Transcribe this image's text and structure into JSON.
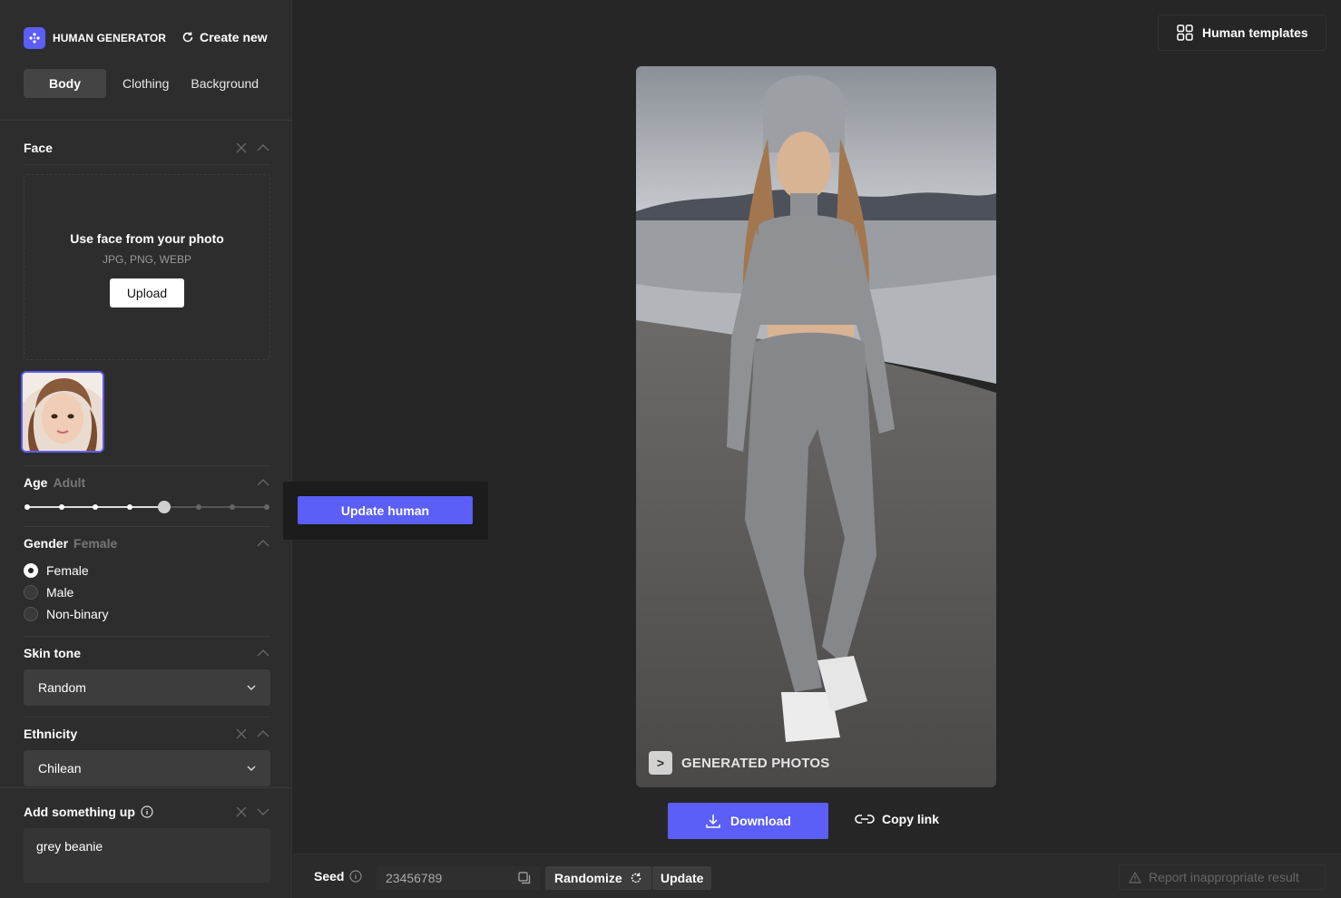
{
  "brand": {
    "name": "HUMAN GENERATOR",
    "accent": "#5b5ef7"
  },
  "header": {
    "create_new": "Create new",
    "templates": "Human templates"
  },
  "tabs": [
    {
      "label": "Body",
      "active": true
    },
    {
      "label": "Clothing",
      "active": false
    },
    {
      "label": "Background",
      "active": false
    }
  ],
  "face": {
    "title": "Face",
    "upload_title": "Use face from your photo",
    "upload_formats": "JPG, PNG, WEBP",
    "upload_button": "Upload"
  },
  "age": {
    "title": "Age",
    "value": "Adult",
    "steps": 8,
    "selected_index": 4
  },
  "gender": {
    "title": "Gender",
    "value": "Female",
    "options": [
      {
        "label": "Female",
        "checked": true
      },
      {
        "label": "Male",
        "checked": false
      },
      {
        "label": "Non-binary",
        "checked": false
      }
    ]
  },
  "skin_tone": {
    "title": "Skin tone",
    "selected": "Random"
  },
  "ethnicity": {
    "title": "Ethnicity",
    "selected": "Chilean"
  },
  "add_something": {
    "title": "Add something up",
    "value": "grey beanie"
  },
  "update_human": "Update human",
  "photo": {
    "watermark": "GENERATED PHOTOS",
    "watermark_mark": ">"
  },
  "actions": {
    "download": "Download",
    "copy_link": "Copy link"
  },
  "bottom": {
    "seed_label": "Seed",
    "seed_value": "23456789",
    "randomize": "Randomize",
    "update": "Update",
    "report": "Report inappropriate result"
  }
}
